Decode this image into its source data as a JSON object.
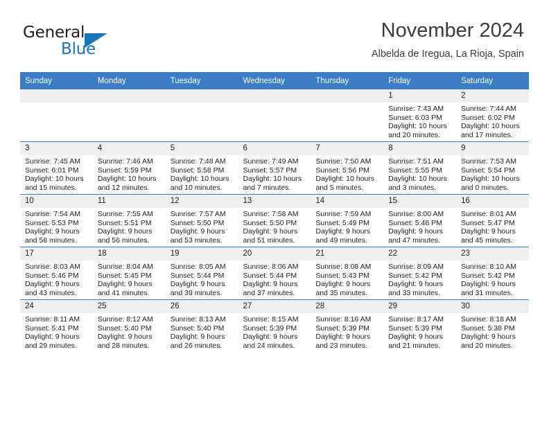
{
  "brand": {
    "name_part1": "General",
    "name_part2": "Blue",
    "logo_icon": "triangle-logo-icon"
  },
  "header": {
    "month_title": "November 2024",
    "location": "Albelda de Iregua, La Rioja, Spain"
  },
  "calendar": {
    "weekday_headers": [
      "Sunday",
      "Monday",
      "Tuesday",
      "Wednesday",
      "Thursday",
      "Friday",
      "Saturday"
    ],
    "accent_color": "#3b7dc4",
    "day_band_color": "#efefef",
    "weeks": [
      [
        {
          "day": "",
          "blank": true
        },
        {
          "day": "",
          "blank": true
        },
        {
          "day": "",
          "blank": true
        },
        {
          "day": "",
          "blank": true
        },
        {
          "day": "",
          "blank": true
        },
        {
          "day": "1",
          "sunrise": "Sunrise: 7:43 AM",
          "sunset": "Sunset: 6:03 PM",
          "daylight": "Daylight: 10 hours and 20 minutes."
        },
        {
          "day": "2",
          "sunrise": "Sunrise: 7:44 AM",
          "sunset": "Sunset: 6:02 PM",
          "daylight": "Daylight: 10 hours and 17 minutes."
        }
      ],
      [
        {
          "day": "3",
          "sunrise": "Sunrise: 7:45 AM",
          "sunset": "Sunset: 6:01 PM",
          "daylight": "Daylight: 10 hours and 15 minutes."
        },
        {
          "day": "4",
          "sunrise": "Sunrise: 7:46 AM",
          "sunset": "Sunset: 5:59 PM",
          "daylight": "Daylight: 10 hours and 12 minutes."
        },
        {
          "day": "5",
          "sunrise": "Sunrise: 7:48 AM",
          "sunset": "Sunset: 5:58 PM",
          "daylight": "Daylight: 10 hours and 10 minutes."
        },
        {
          "day": "6",
          "sunrise": "Sunrise: 7:49 AM",
          "sunset": "Sunset: 5:57 PM",
          "daylight": "Daylight: 10 hours and 7 minutes."
        },
        {
          "day": "7",
          "sunrise": "Sunrise: 7:50 AM",
          "sunset": "Sunset: 5:56 PM",
          "daylight": "Daylight: 10 hours and 5 minutes."
        },
        {
          "day": "8",
          "sunrise": "Sunrise: 7:51 AM",
          "sunset": "Sunset: 5:55 PM",
          "daylight": "Daylight: 10 hours and 3 minutes."
        },
        {
          "day": "9",
          "sunrise": "Sunrise: 7:53 AM",
          "sunset": "Sunset: 5:54 PM",
          "daylight": "Daylight: 10 hours and 0 minutes."
        }
      ],
      [
        {
          "day": "10",
          "sunrise": "Sunrise: 7:54 AM",
          "sunset": "Sunset: 5:53 PM",
          "daylight": "Daylight: 9 hours and 58 minutes."
        },
        {
          "day": "11",
          "sunrise": "Sunrise: 7:55 AM",
          "sunset": "Sunset: 5:51 PM",
          "daylight": "Daylight: 9 hours and 56 minutes."
        },
        {
          "day": "12",
          "sunrise": "Sunrise: 7:57 AM",
          "sunset": "Sunset: 5:50 PM",
          "daylight": "Daylight: 9 hours and 53 minutes."
        },
        {
          "day": "13",
          "sunrise": "Sunrise: 7:58 AM",
          "sunset": "Sunset: 5:50 PM",
          "daylight": "Daylight: 9 hours and 51 minutes."
        },
        {
          "day": "14",
          "sunrise": "Sunrise: 7:59 AM",
          "sunset": "Sunset: 5:49 PM",
          "daylight": "Daylight: 9 hours and 49 minutes."
        },
        {
          "day": "15",
          "sunrise": "Sunrise: 8:00 AM",
          "sunset": "Sunset: 5:48 PM",
          "daylight": "Daylight: 9 hours and 47 minutes."
        },
        {
          "day": "16",
          "sunrise": "Sunrise: 8:01 AM",
          "sunset": "Sunset: 5:47 PM",
          "daylight": "Daylight: 9 hours and 45 minutes."
        }
      ],
      [
        {
          "day": "17",
          "sunrise": "Sunrise: 8:03 AM",
          "sunset": "Sunset: 5:46 PM",
          "daylight": "Daylight: 9 hours and 43 minutes."
        },
        {
          "day": "18",
          "sunrise": "Sunrise: 8:04 AM",
          "sunset": "Sunset: 5:45 PM",
          "daylight": "Daylight: 9 hours and 41 minutes."
        },
        {
          "day": "19",
          "sunrise": "Sunrise: 8:05 AM",
          "sunset": "Sunset: 5:44 PM",
          "daylight": "Daylight: 9 hours and 39 minutes."
        },
        {
          "day": "20",
          "sunrise": "Sunrise: 8:06 AM",
          "sunset": "Sunset: 5:44 PM",
          "daylight": "Daylight: 9 hours and 37 minutes."
        },
        {
          "day": "21",
          "sunrise": "Sunrise: 8:08 AM",
          "sunset": "Sunset: 5:43 PM",
          "daylight": "Daylight: 9 hours and 35 minutes."
        },
        {
          "day": "22",
          "sunrise": "Sunrise: 8:09 AM",
          "sunset": "Sunset: 5:42 PM",
          "daylight": "Daylight: 9 hours and 33 minutes."
        },
        {
          "day": "23",
          "sunrise": "Sunrise: 8:10 AM",
          "sunset": "Sunset: 5:42 PM",
          "daylight": "Daylight: 9 hours and 31 minutes."
        }
      ],
      [
        {
          "day": "24",
          "sunrise": "Sunrise: 8:11 AM",
          "sunset": "Sunset: 5:41 PM",
          "daylight": "Daylight: 9 hours and 29 minutes."
        },
        {
          "day": "25",
          "sunrise": "Sunrise: 8:12 AM",
          "sunset": "Sunset: 5:40 PM",
          "daylight": "Daylight: 9 hours and 28 minutes."
        },
        {
          "day": "26",
          "sunrise": "Sunrise: 8:13 AM",
          "sunset": "Sunset: 5:40 PM",
          "daylight": "Daylight: 9 hours and 26 minutes."
        },
        {
          "day": "27",
          "sunrise": "Sunrise: 8:15 AM",
          "sunset": "Sunset: 5:39 PM",
          "daylight": "Daylight: 9 hours and 24 minutes."
        },
        {
          "day": "28",
          "sunrise": "Sunrise: 8:16 AM",
          "sunset": "Sunset: 5:39 PM",
          "daylight": "Daylight: 9 hours and 23 minutes."
        },
        {
          "day": "29",
          "sunrise": "Sunrise: 8:17 AM",
          "sunset": "Sunset: 5:39 PM",
          "daylight": "Daylight: 9 hours and 21 minutes."
        },
        {
          "day": "30",
          "sunrise": "Sunrise: 8:18 AM",
          "sunset": "Sunset: 5:38 PM",
          "daylight": "Daylight: 9 hours and 20 minutes."
        }
      ]
    ]
  }
}
